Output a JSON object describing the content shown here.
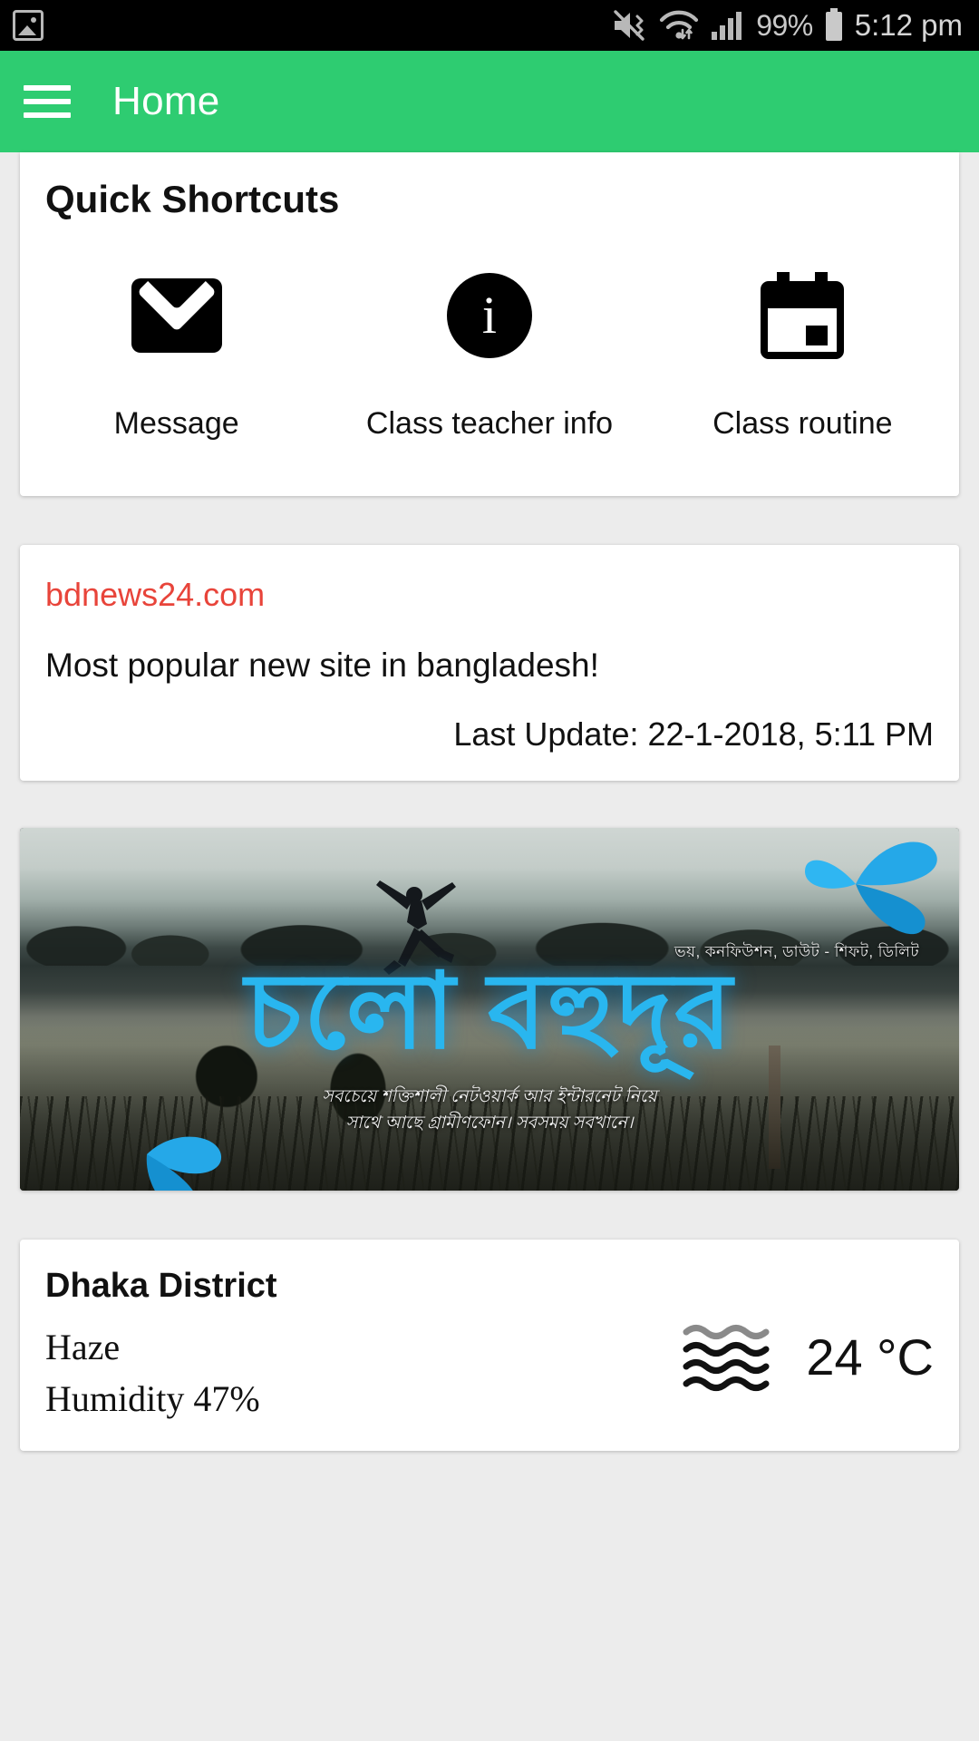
{
  "status_bar": {
    "photo_icon": "photo-icon",
    "mute_icon": "mute-vibrate-icon",
    "wifi_icon": "wifi-icon",
    "signal_icon": "cellular-signal-icon",
    "battery_percent": "99%",
    "battery_icon": "battery-icon",
    "time": "5:12 pm"
  },
  "app_bar": {
    "menu_icon": "hamburger-menu-icon",
    "title": "Home"
  },
  "shortcuts": {
    "title": "Quick Shortcuts",
    "items": [
      {
        "label": "Message",
        "icon": "envelope-icon"
      },
      {
        "label": "Class teacher info",
        "icon": "info-circle-icon"
      },
      {
        "label": "Class routine",
        "icon": "calendar-icon"
      }
    ]
  },
  "news": {
    "site": "bdnews24.com",
    "site_color": "#e8443a",
    "description": "Most popular new site in bangladesh!",
    "last_update": "Last Update: 22-1-2018, 5:11 PM"
  },
  "banner": {
    "headline": "চলো বহুদূর",
    "kicker": "ভয়, কনফিউশন, ডাউট - শিফট, ডিলিট",
    "subtitle_line1": "সবচেয়ে শক্তিশালী নেটওয়ার্ক আর ইন্টারনেট নিয়ে",
    "subtitle_line2": "সাথে আছে গ্রামীণফোন। সবসময় সবখানে।",
    "brand_icon": "grameenphone-butterfly-icon",
    "headline_color": "#29b6ef"
  },
  "weather": {
    "city": "Dhaka District",
    "condition": "Haze",
    "humidity": "Humidity 47%",
    "temperature": "24 °C",
    "icon": "haze-waves-icon"
  }
}
